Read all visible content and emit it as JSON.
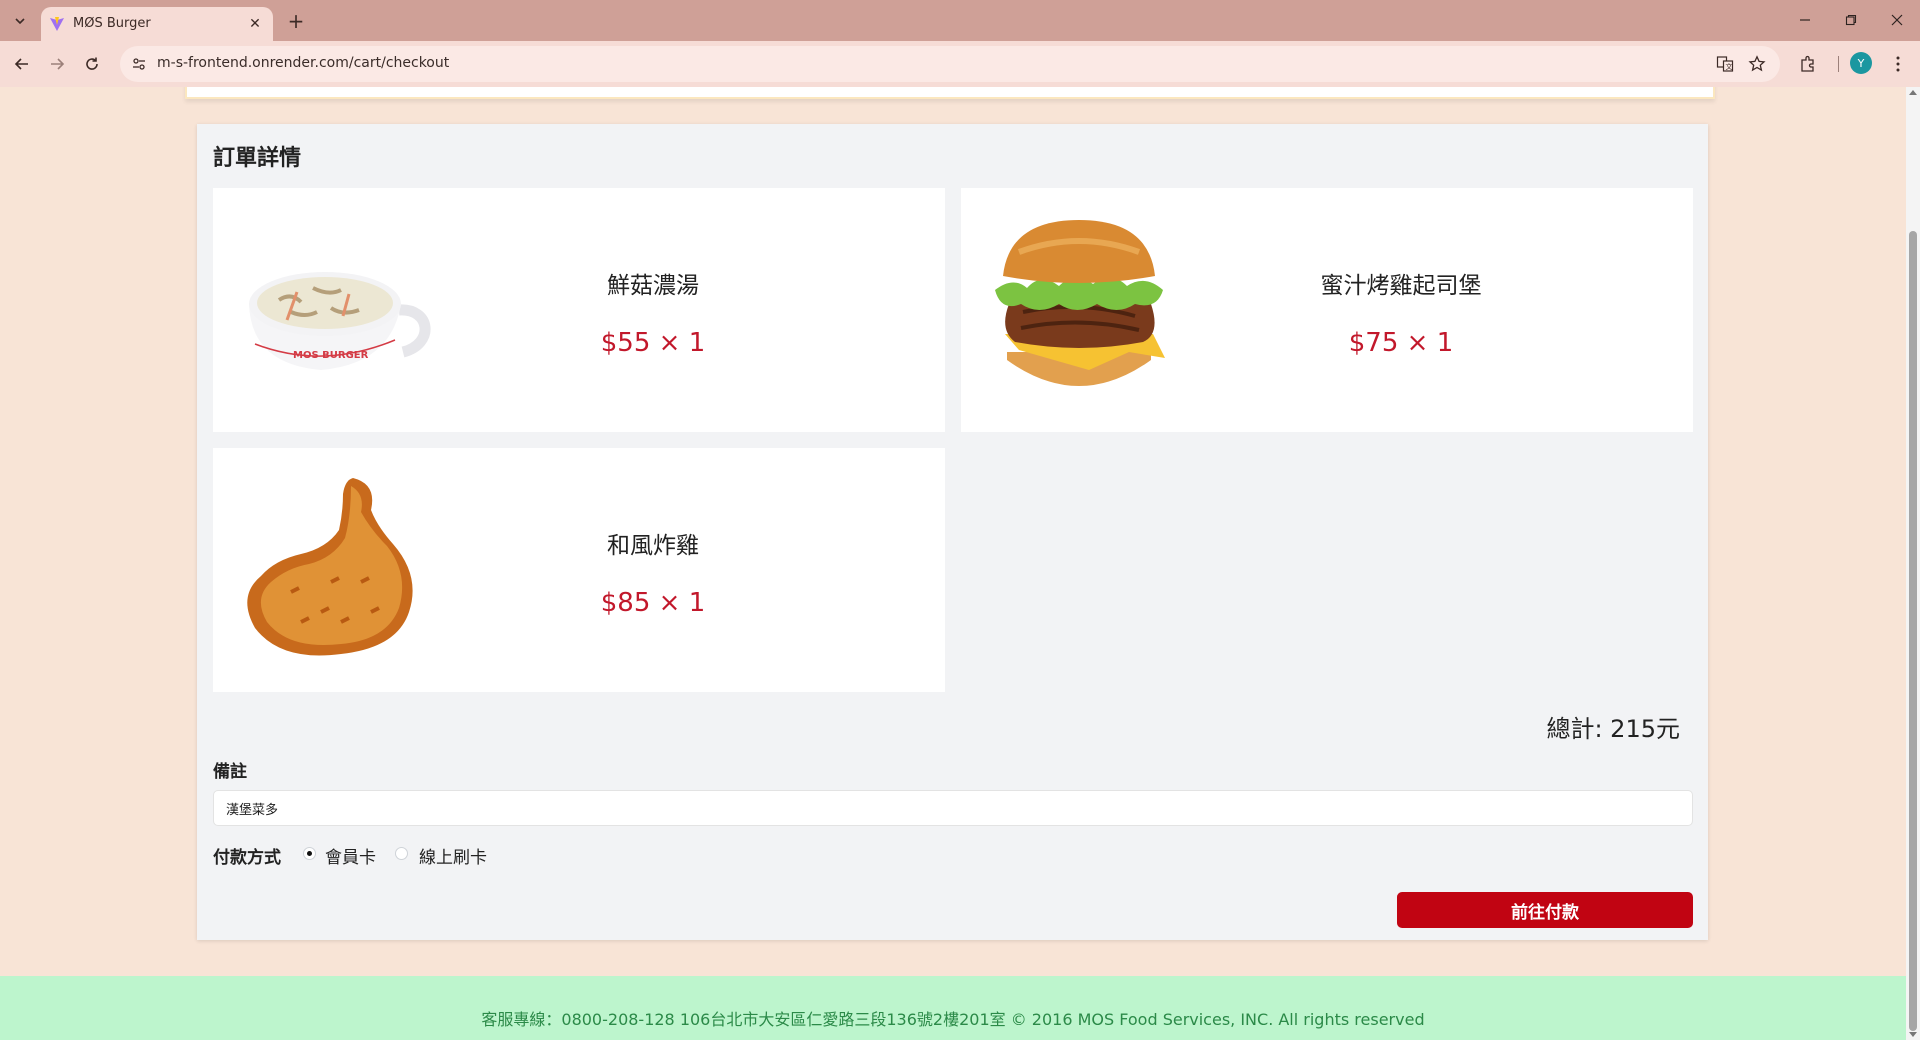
{
  "browser": {
    "tab_title": "MØS Burger",
    "url": "m-s-frontend.onrender.com/cart/checkout",
    "avatar_letter": "Y",
    "colors": {
      "frame": "#cfa097",
      "toolbar": "#f6dcd6",
      "avatar": "#1b97a0"
    }
  },
  "order": {
    "title": "訂單詳情",
    "items": [
      {
        "name": "鮮菇濃湯",
        "price_text": "$55 × 1",
        "icon": "mushroom-soup-image"
      },
      {
        "name": "蜜汁烤雞起司堡",
        "price_text": "$75 × 1",
        "icon": "chicken-cheese-burger-image"
      },
      {
        "name": "和風炸雞",
        "price_text": "$85 × 1",
        "icon": "fried-chicken-image"
      }
    ],
    "total_text": "總計: 215元",
    "note_label": "備註",
    "note_value": "漢堡菜多",
    "payment_label": "付款方式",
    "payment_options": [
      {
        "label": "會員卡",
        "selected": true
      },
      {
        "label": "線上刷卡",
        "selected": false
      }
    ],
    "submit_label": "前往付款",
    "colors": {
      "price": "#c2182b",
      "button": "#c10412",
      "page_bg": "#f8e4d6"
    }
  },
  "footer": {
    "text": "客服專線：0800-208-128 106台北市大安區仁愛路三段136號2樓201室 © 2016 MOS Food Services, INC. All rights reserved",
    "colors": {
      "bg": "#bdf5cd",
      "text": "#2b8a48"
    }
  }
}
